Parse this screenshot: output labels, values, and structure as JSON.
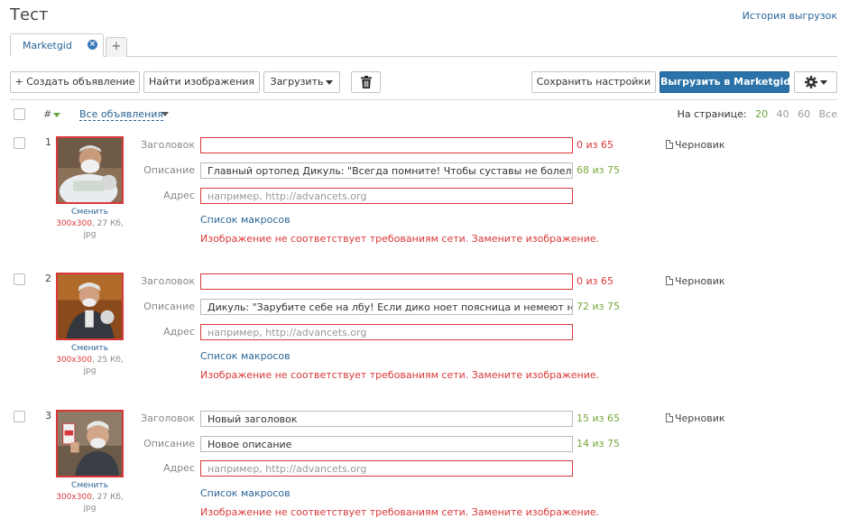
{
  "page": {
    "title": "Тест",
    "history_link": "История выгрузок"
  },
  "tabs": [
    {
      "label": "Marketgid",
      "close": "×"
    }
  ],
  "tab_add": "+",
  "toolbar": {
    "create_ad": "+ Создать объявление",
    "find_images": "Найти изображения",
    "upload": "Загрузить",
    "save_settings": "Сохранить настройки",
    "export": "Выгрузить в Marketgid"
  },
  "list_header": {
    "hash": "#",
    "filter": "Все объявления",
    "per_page_label": "На странице:",
    "per_page_options": [
      "20",
      "40",
      "60",
      "Все"
    ],
    "per_page_active": "20"
  },
  "labels": {
    "title": "Заголовок",
    "description": "Описание",
    "address": "Адрес",
    "macros": "Список макросов",
    "change": "Сменить",
    "address_placeholder": "например, http://advancets.org"
  },
  "ads": [
    {
      "num": "1",
      "image_size": "300x300",
      "image_weight": ", 27 Кб,",
      "image_ext": "jpg",
      "title": "",
      "title_counter": "0 из 65",
      "description": "Главный ортопед Дикуль: \"Всегда помните! Чтобы суставы не болели...",
      "description_counter": "68 из 75",
      "error": "Изображение не соответствует требованиям сети. Замените изображение.",
      "status": "Черновик"
    },
    {
      "num": "2",
      "image_size": "300x300",
      "image_weight": ", 25 Кб,",
      "image_ext": "jpg",
      "title": "",
      "title_counter": "0 из 65",
      "description": "Дикуль: \"Зарубите себе на лбу! Если дико ноет поясница и немеют ног",
      "description_counter": "72 из 75",
      "error": "Изображение не соответствует требованиям сети. Замените изображение.",
      "status": "Черновик"
    },
    {
      "num": "3",
      "image_size": "300x300",
      "image_weight": ", 27 Кб,",
      "image_ext": "jpg",
      "title": "Новый заголовок",
      "title_counter": "15 из 65",
      "description": "Новое описание",
      "description_counter": "14 из 75",
      "error": "Изображение не соответствует требованиям сети. Замените изображение.",
      "status": "Черновик"
    }
  ],
  "colors": {
    "accent": "#2a72a8",
    "error": "#d9383a",
    "ok": "#79a83c"
  }
}
